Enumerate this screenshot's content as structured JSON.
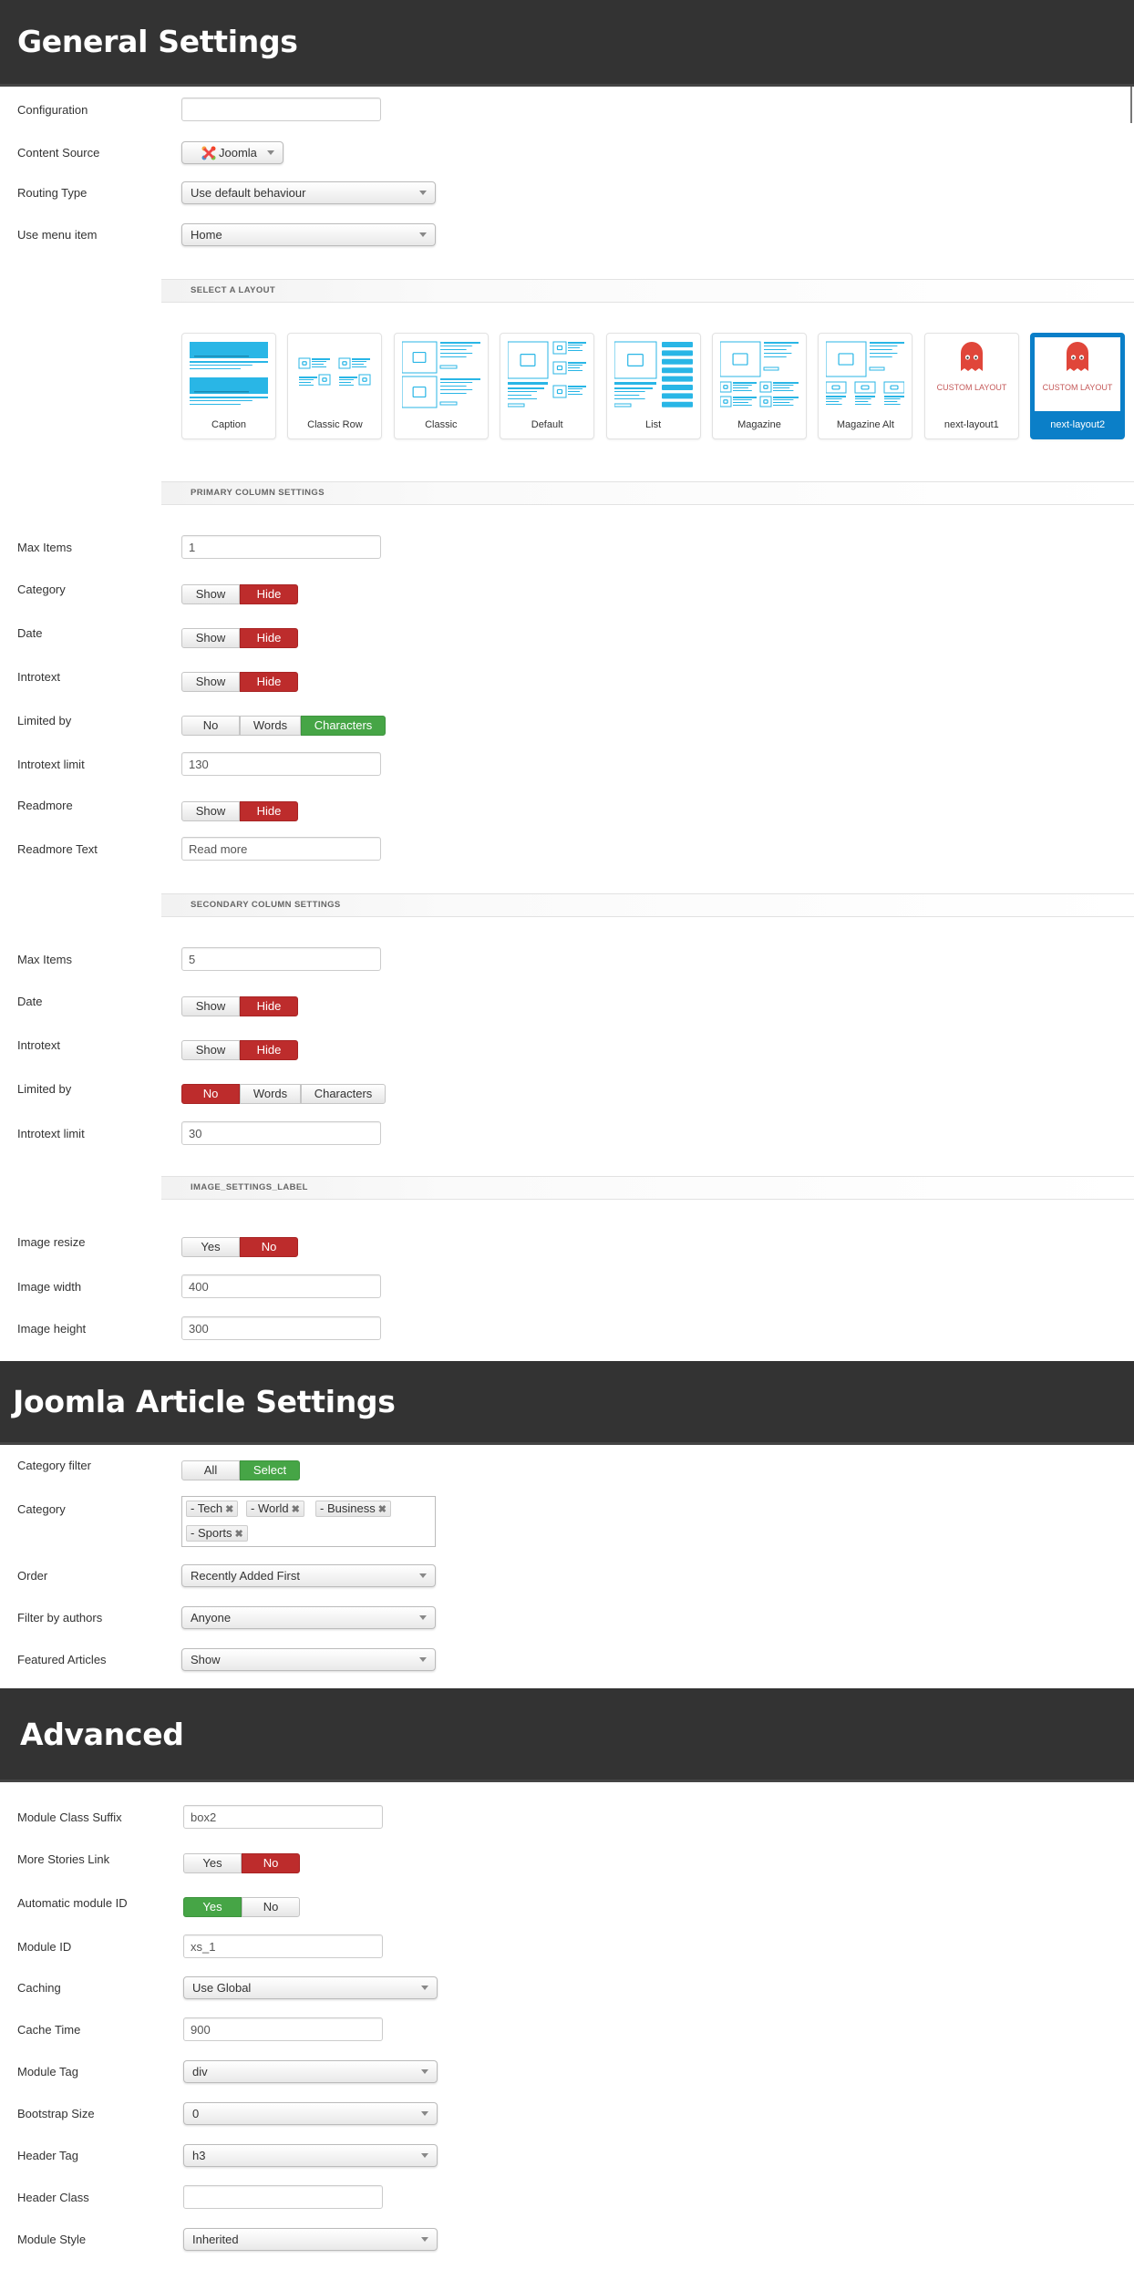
{
  "sections": {
    "general": {
      "title": "General Settings"
    },
    "joomla": {
      "title": "Joomla Article Settings"
    },
    "advanced": {
      "title": "Advanced"
    }
  },
  "general": {
    "configuration": {
      "label": "Configuration",
      "value": ""
    },
    "content_source": {
      "label": "Content Source",
      "value": "Joomla",
      "icon": "joomla-logo-icon"
    },
    "routing_type": {
      "label": "Routing Type",
      "value": "Use default behaviour"
    },
    "use_menu_item": {
      "label": "Use menu item",
      "value": "Home"
    }
  },
  "layout": {
    "heading": "SELECT A LAYOUT",
    "selected": "next-layout2",
    "cards": [
      {
        "name": "Caption",
        "icon": "caption-layout-icon"
      },
      {
        "name": "Classic Row",
        "icon": "classic-row-layout-icon"
      },
      {
        "name": "Classic",
        "icon": "classic-layout-icon"
      },
      {
        "name": "Default",
        "icon": "default-layout-icon"
      },
      {
        "name": "List",
        "icon": "list-layout-icon"
      },
      {
        "name": "Magazine",
        "icon": "magazine-layout-icon"
      },
      {
        "name": "Magazine Alt",
        "icon": "magazine-alt-layout-icon"
      },
      {
        "name": "next-layout1",
        "icon": "ghost-icon",
        "caption": "CUSTOM LAYOUT"
      },
      {
        "name": "next-layout2",
        "icon": "ghost-icon",
        "caption": "CUSTOM LAYOUT"
      }
    ]
  },
  "primary": {
    "heading": "PRIMARY COLUMN SETTINGS",
    "max_items": {
      "label": "Max Items",
      "value": "1"
    },
    "category": {
      "label": "Category",
      "options": [
        "Show",
        "Hide"
      ],
      "selected": "Hide"
    },
    "date": {
      "label": "Date",
      "options": [
        "Show",
        "Hide"
      ],
      "selected": "Hide"
    },
    "introtext": {
      "label": "Introtext",
      "options": [
        "Show",
        "Hide"
      ],
      "selected": "Hide"
    },
    "limited_by": {
      "label": "Limited by",
      "options": [
        "No",
        "Words",
        "Characters"
      ],
      "selected": "Characters"
    },
    "introtext_limit": {
      "label": "Introtext limit",
      "value": "130"
    },
    "readmore": {
      "label": "Readmore",
      "options": [
        "Show",
        "Hide"
      ],
      "selected": "Hide"
    },
    "readmore_text": {
      "label": "Readmore Text",
      "value": "Read more"
    }
  },
  "secondary": {
    "heading": "SECONDARY COLUMN SETTINGS",
    "max_items": {
      "label": "Max Items",
      "value": "5"
    },
    "date": {
      "label": "Date",
      "options": [
        "Show",
        "Hide"
      ],
      "selected": "Hide"
    },
    "introtext": {
      "label": "Introtext",
      "options": [
        "Show",
        "Hide"
      ],
      "selected": "Hide"
    },
    "limited_by": {
      "label": "Limited by",
      "options": [
        "No",
        "Words",
        "Characters"
      ],
      "selected": "No"
    },
    "introtext_limit": {
      "label": "Introtext limit",
      "value": "30"
    }
  },
  "image": {
    "heading": "IMAGE_SETTINGS_LABEL",
    "resize": {
      "label": "Image resize",
      "options": [
        "Yes",
        "No"
      ],
      "selected": "No"
    },
    "width": {
      "label": "Image width",
      "value": "400"
    },
    "height": {
      "label": "Image height",
      "value": "300"
    }
  },
  "joomla": {
    "category_filter": {
      "label": "Category filter",
      "options": [
        "All",
        "Select"
      ],
      "selected": "Select"
    },
    "category": {
      "label": "Category",
      "tags": [
        "- Tech",
        "- World",
        "- Business",
        "- Sports"
      ],
      "remove_icon": "close-icon"
    },
    "order": {
      "label": "Order",
      "value": "Recently Added First"
    },
    "filter_authors": {
      "label": "Filter by authors",
      "value": "Anyone"
    },
    "featured": {
      "label": "Featured Articles",
      "value": "Show"
    }
  },
  "advanced": {
    "class_suffix": {
      "label": "Module Class Suffix",
      "value": "box2"
    },
    "more_stories": {
      "label": "More Stories Link",
      "options": [
        "Yes",
        "No"
      ],
      "selected": "No"
    },
    "auto_id": {
      "label": "Automatic module ID",
      "options": [
        "Yes",
        "No"
      ],
      "selected": "Yes"
    },
    "module_id": {
      "label": "Module ID",
      "value": "xs_1"
    },
    "caching": {
      "label": "Caching",
      "value": "Use Global"
    },
    "cache_time": {
      "label": "Cache Time",
      "value": "900"
    },
    "module_tag": {
      "label": "Module Tag",
      "value": "div"
    },
    "bootstrap_size": {
      "label": "Bootstrap Size",
      "value": "0"
    },
    "header_tag": {
      "label": "Header Tag",
      "value": "h3"
    },
    "header_class": {
      "label": "Header Class",
      "value": ""
    },
    "module_style": {
      "label": "Module Style",
      "value": "Inherited"
    }
  },
  "colors": {
    "header_bg": "#333333",
    "active_red": "#bd2c2c",
    "active_green": "#46a546",
    "layout_accent": "#29b6e6",
    "selected_card": "#0b7fc8",
    "ghost": "#e0463a"
  }
}
